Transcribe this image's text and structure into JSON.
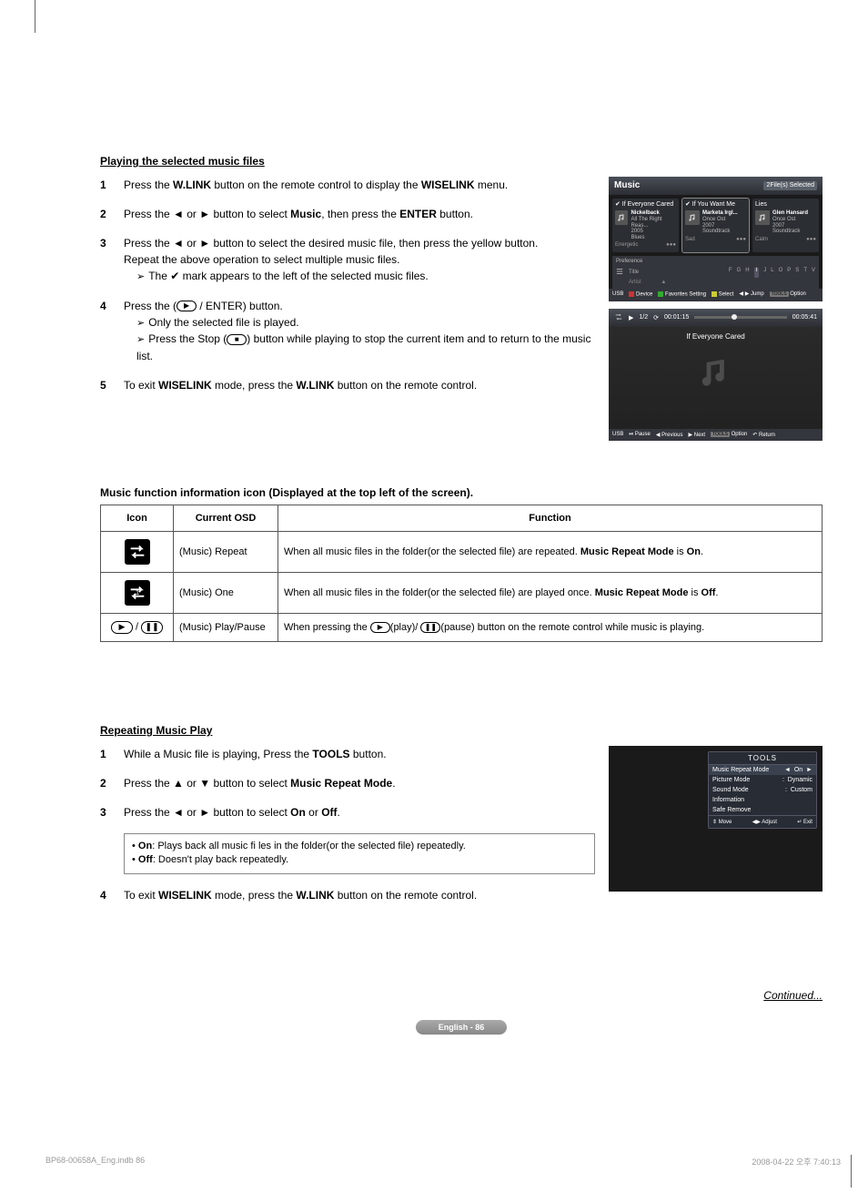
{
  "section1_title": "Playing the selected music files",
  "steps1": [
    {
      "n": "1",
      "body": "Press the <b>W.LINK</b> button on the remote control to display the <b>WISELINK</b> menu.",
      "subs": []
    },
    {
      "n": "2",
      "body": "Press the ◄ or ► button to select <b>Music</b>, then press the <b>ENTER</b> button.",
      "subs": []
    },
    {
      "n": "3",
      "body": "Press the ◄ or ► button to select the desired music file, then press the yellow button.<br>Repeat the above operation to select multiple music files.",
      "subs": [
        "The <span class='check'>✔</span> mark appears to the left of the selected music files."
      ]
    },
    {
      "n": "4",
      "body": "Press the (<span class='btn-icon'>▶</span> / ENTER) button.",
      "subs": [
        "Only the selected file is played.",
        "Press the Stop (<span class='btn-icon'>■</span>) button while playing to stop the current item and to return to the music list."
      ]
    },
    {
      "n": "5",
      "body": "To exit <b>WISELINK</b> mode, press the <b>W.LINK</b> button on the remote control.",
      "subs": []
    }
  ],
  "music_screen": {
    "title": "Music",
    "tag": "2File(s) Selected",
    "cards": [
      {
        "title": "If Everyone Cared",
        "artist": "Nickelback",
        "album": "All The Right Reas...",
        "year": "2005",
        "genre": "Blues",
        "mood": "Energetic"
      },
      {
        "title": "If You Want Me",
        "artist": "Marketa Irgl...",
        "album": "Once Ost",
        "year": "2007",
        "genre": "Soundtrack",
        "mood": "Sad"
      },
      {
        "title": "Lies",
        "artist": "Glen Hansard",
        "album": "Once Ost",
        "year": "2007",
        "genre": "Soundtrack",
        "mood": "Calm"
      }
    ],
    "pref_label": "Preference",
    "sort_label_left": "Title",
    "sort_label_bottom": "Artist",
    "alpha": [
      "F",
      "G",
      "H",
      "I",
      "J",
      "L",
      "O",
      "P",
      "S",
      "T",
      "V"
    ],
    "bottombar": {
      "usb": "USB",
      "items": [
        "Device",
        "Favorites Setting",
        "Select",
        "Jump",
        "Option"
      ],
      "jump_sym": "◀ ▶",
      "tools": "TOOLS"
    }
  },
  "player_screen": {
    "pos": "1/2",
    "elapsed": "00:01:15",
    "total": "00:05:41",
    "song": "If Everyone Cared",
    "bottom": {
      "usb": "USB",
      "items": [
        "Pause",
        "Previous",
        "Next",
        "Option",
        "Return"
      ],
      "tools": "TOOLS"
    }
  },
  "table_heading": "Music function information icon (Displayed at the top left of the screen).",
  "table": {
    "headers": [
      "Icon",
      "Current OSD",
      "Function"
    ],
    "rows": [
      {
        "icon": "repeat",
        "osd": "(Music) Repeat",
        "func": "When all music files in the folder(or the selected file) are repeated. <b>Music Repeat Mode</b> is <b>On</b>."
      },
      {
        "icon": "one",
        "osd": "(Music) One",
        "func": "When all music files in the folder(or the selected file) are played once. <b>Music Repeat Mode</b> is <b>Off</b>."
      },
      {
        "icon": "playpause",
        "osd": "(Music) Play/Pause",
        "func": "When pressing the <span class='btn-icon'>▶</span>(play)/ <span class='btn-icon'>❚❚</span>(pause) button on the remote control while music is playing."
      }
    ]
  },
  "section2_title": "Repeating Music Play",
  "steps2": [
    {
      "n": "1",
      "body": "While a Music file is playing, Press the <b>TOOLS</b> button."
    },
    {
      "n": "2",
      "body": "Press the ▲ or ▼ button to select <b>Music Repeat Mode</b>."
    },
    {
      "n": "3",
      "body": "Press the ◄ or ► button to select <b>On</b> or <b>Off</b>."
    },
    {
      "n": "4",
      "body": "To exit <b>WISELINK</b> mode, press the <b>W.LINK</b> button on the remote control."
    }
  ],
  "note_on": "On",
  "note_on_desc": ": Plays back all music fi les in the folder(or the selected file) repeatedly.",
  "note_off": "Off",
  "note_off_desc": ": Doesn't play back repeatedly.",
  "tools_screen": {
    "header": "TOOLS",
    "rows": [
      {
        "label": "Music Repeat Mode",
        "value": "On",
        "sel": true,
        "arrows": true
      },
      {
        "label": "Picture Mode",
        "value": "Dynamic",
        "sep": ":"
      },
      {
        "label": "Sound Mode",
        "value": "Custom",
        "sep": ":"
      },
      {
        "label": "Information",
        "value": ""
      },
      {
        "label": "Safe Remove",
        "value": ""
      }
    ],
    "footer": [
      "Move",
      "Adjust",
      "Exit"
    ],
    "footer_sym": [
      "⇕",
      "◀▶",
      "↵"
    ]
  },
  "continued": "Continued...",
  "page_chip": "English - 86",
  "footer_left": "BP68-00658A_Eng.indb   86",
  "footer_right": "2008-04-22   오후 7:40:13"
}
